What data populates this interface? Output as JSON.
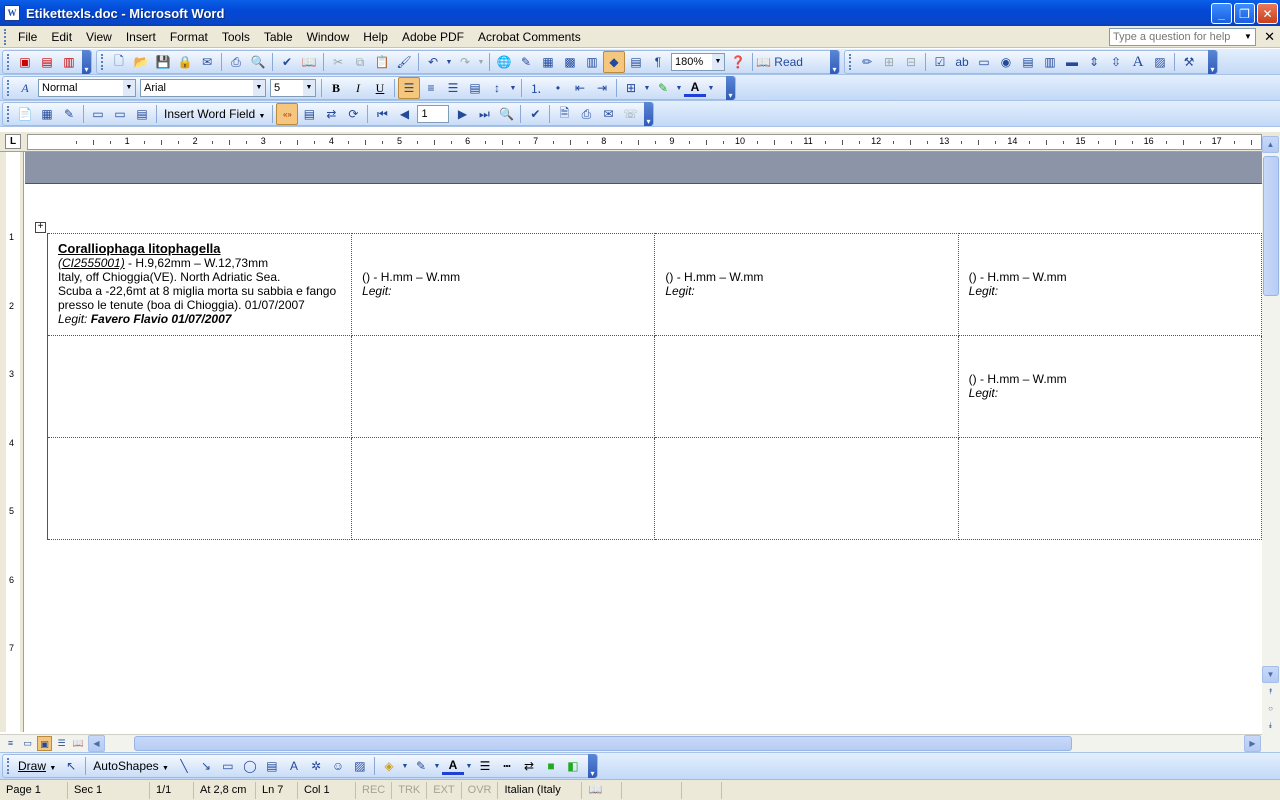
{
  "window": {
    "title": "Etikettexls.doc - Microsoft Word",
    "minimize": "_",
    "restore": "❐",
    "close": "✕"
  },
  "menu": {
    "items": [
      "File",
      "Edit",
      "View",
      "Insert",
      "Format",
      "Tools",
      "Table",
      "Window",
      "Help",
      "Adobe PDF",
      "Acrobat Comments"
    ],
    "help_placeholder": "Type a question for help",
    "doc_close": "✕"
  },
  "toolbar_standard": {
    "zoom": "180%",
    "read_label": "Read"
  },
  "toolbar_formatting": {
    "style": "Normal",
    "font": "Arial",
    "size": "5"
  },
  "toolbar_mailmerge": {
    "insert_word_field": "Insert Word Field",
    "record": "1"
  },
  "ruler": {
    "numbers": [
      "1",
      "2",
      "3",
      "4",
      "5",
      "6",
      "7",
      "8",
      "9",
      "10",
      "11",
      "12",
      "13",
      "14",
      "15",
      "16",
      "17"
    ],
    "vnumbers": [
      "1",
      "2",
      "3",
      "4",
      "5",
      "6",
      "7"
    ],
    "tab_selector": "L"
  },
  "table": {
    "rows": [
      [
        {
          "name": "Coralliophaga  litophagella",
          "code": "(CI2555001)",
          "dims": " - H.9,62mm – W.12,73mm",
          "lines": [
            "Italy, off Chioggia(VE). North Adriatic Sea.",
            "Scuba a -22,6mt at 8 miglia morta su sabbia e fango",
            "presso le tenute (boa di Chioggia). 01/07/2007"
          ],
          "legit_label": "Legit: ",
          "legit_value": "Favero Flavio 01/07/2007"
        },
        {
          "dims": "() - H.mm – W.mm",
          "legit_label": "Legit:"
        },
        {
          "dims": "() - H.mm – W.mm",
          "legit_label": "Legit:"
        },
        {
          "dims": "() - H.mm – W.mm",
          "legit_label": "Legit:"
        }
      ],
      [
        {},
        {},
        {},
        {
          "dims": "() - H.mm – W.mm",
          "legit_label": "Legit:"
        }
      ],
      [
        {},
        {},
        {},
        {}
      ]
    ]
  },
  "drawing": {
    "draw_label": "Draw",
    "autoshapes_label": "AutoShapes"
  },
  "status": {
    "page": "Page  1",
    "sec": "Sec  1",
    "pages": "1/1",
    "at": "At  2,8 cm",
    "ln": "Ln  7",
    "col": "Col  1",
    "rec": "REC",
    "trk": "TRK",
    "ext": "EXT",
    "ovr": "OVR",
    "language": "Italian (Italy"
  }
}
